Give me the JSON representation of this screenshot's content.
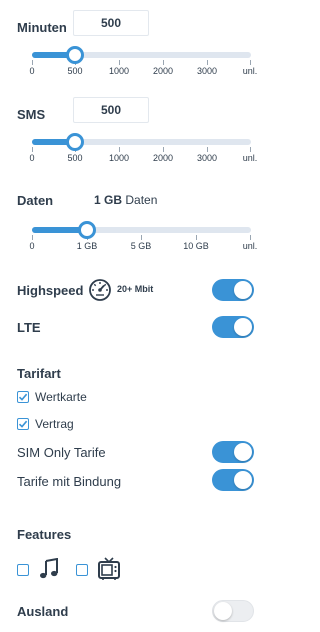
{
  "minuten": {
    "label": "Minuten",
    "value": "500",
    "ticks": [
      "0",
      "500",
      "1000",
      "2000",
      "3000",
      "unl."
    ]
  },
  "sms": {
    "label": "SMS",
    "value": "500",
    "ticks": [
      "0",
      "500",
      "1000",
      "2000",
      "3000",
      "unl."
    ]
  },
  "daten": {
    "label": "Daten",
    "value_bold": "1 GB",
    "value_suffix": "Daten",
    "ticks": [
      "0",
      "1 GB",
      "5 GB",
      "10 GB",
      "unl."
    ]
  },
  "highspeed": {
    "label": "Highspeed",
    "speed": "20+ Mbit",
    "icon": "speedometer-icon",
    "enabled": true
  },
  "lte": {
    "label": "LTE",
    "enabled": true
  },
  "tarifart": {
    "heading": "Tarifart",
    "options": [
      {
        "label": "Wertkarte",
        "checked": true
      },
      {
        "label": "Vertrag",
        "checked": true
      }
    ]
  },
  "sim_only": {
    "label": "SIM Only Tarife",
    "enabled": true
  },
  "bindung": {
    "label": "Tarife mit Bindung",
    "enabled": true
  },
  "features": {
    "heading": "Features",
    "items": [
      {
        "icon": "music-note-icon",
        "checked": false
      },
      {
        "icon": "tv-icon",
        "checked": false
      }
    ]
  },
  "ausland": {
    "label": "Ausland",
    "enabled": false
  },
  "colors": {
    "accent": "#3a93d6",
    "track": "#dfe6ef",
    "text": "#2f3d4c"
  }
}
